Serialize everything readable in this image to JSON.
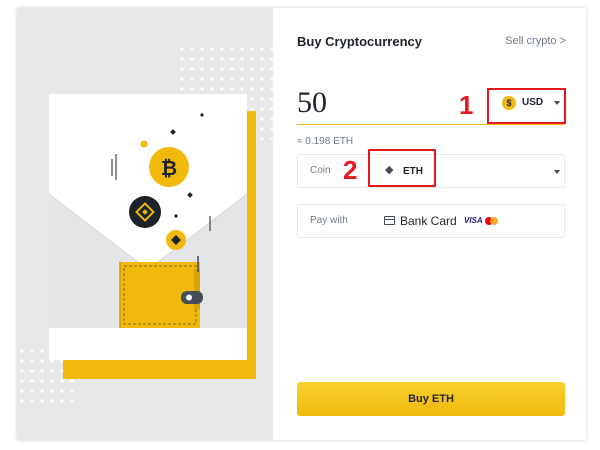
{
  "header": {
    "title": "Buy Cryptocurrency",
    "sell_link": "Sell crypto >"
  },
  "amount": {
    "value": "50",
    "currency": "USD",
    "currency_icon": "dollar-coin-icon",
    "conversion": "≈ 0.198 ETH"
  },
  "coin": {
    "label": "Coin",
    "selected": "ETH",
    "icon": "ethereum-icon"
  },
  "pay_with": {
    "label": "Pay with",
    "method": "Bank Card",
    "brands": [
      "VISA",
      "Mastercard"
    ]
  },
  "buy_button": {
    "label": "Buy ETH"
  },
  "annotations": {
    "marker_1": "1",
    "marker_2": "2",
    "color": "#e3191e"
  },
  "colors": {
    "accent": "#f0b90b",
    "text": "#1e2329",
    "muted": "#707a8a"
  }
}
